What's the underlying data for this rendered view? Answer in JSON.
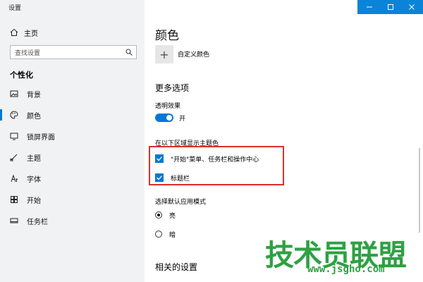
{
  "window": {
    "title": "设置"
  },
  "sidebar": {
    "home_label": "主页",
    "search_placeholder": "查找设置",
    "section_title": "个性化",
    "items": [
      {
        "label": "背景",
        "icon": "image-icon"
      },
      {
        "label": "颜色",
        "icon": "palette-icon",
        "selected": true
      },
      {
        "label": "锁屏界面",
        "icon": "monitor-icon"
      },
      {
        "label": "主题",
        "icon": "brush-icon"
      },
      {
        "label": "字体",
        "icon": "font-icon"
      },
      {
        "label": "开始",
        "icon": "start-icon"
      },
      {
        "label": "任务栏",
        "icon": "taskbar-icon"
      }
    ]
  },
  "main": {
    "heading": "颜色",
    "custom_color_label": "自定义颜色",
    "more_options_title": "更多选项",
    "transparency_label": "透明效果",
    "transparency_state": "开",
    "accent_surfaces_title": "在以下区域显示主题色",
    "checkbox_start": "\"开始\"菜单、任务栏和操作中心",
    "checkbox_titlebar": "标题栏",
    "app_mode_title": "选择默认应用模式",
    "mode_light": "亮",
    "mode_dark": "暗",
    "related_title": "相关的设置"
  },
  "watermark": {
    "text": "技术员联盟",
    "url": "www.jsgho.com"
  },
  "colors": {
    "accent": "#0078d7",
    "highlight_frame": "#d9312b",
    "watermark": "#2ea143"
  }
}
